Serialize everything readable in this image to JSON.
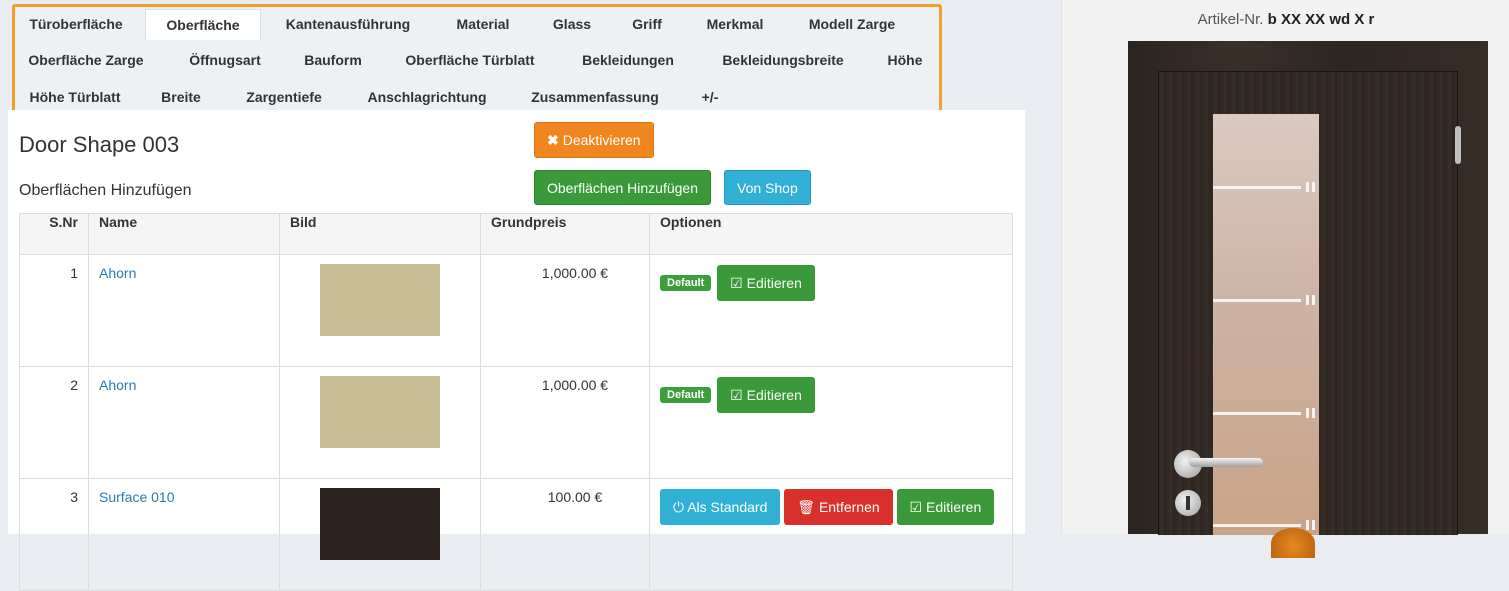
{
  "tabs": {
    "row1": [
      "Türoberfläche",
      "Oberfläche",
      "Kantenausführung",
      "Material",
      "Glass",
      "Griff",
      "Merkmal",
      "Modell Zarge"
    ],
    "row2": [
      "Oberfläche Zarge",
      "Öffnugsart",
      "Bauform",
      "Oberfläche Türblatt",
      "Bekleidungen",
      "Bekleidungsbreite",
      "Höhe"
    ],
    "row3": [
      "Höhe Türblatt",
      "Breite",
      "Zargentiefe",
      "Anschlagrichtung",
      "Zusammenfassung",
      "+/-"
    ],
    "active": "Oberfläche"
  },
  "main": {
    "title": "Door Shape 003",
    "section_title": "Oberflächen Hinzufügen",
    "deactivate_label": "Deaktivieren",
    "add_surfaces_label": "Oberflächen Hinzufügen",
    "from_shop_label": "Von Shop"
  },
  "table": {
    "headers": [
      "S.Nr",
      "Name",
      "Bild",
      "Grundpreis",
      "Optionen"
    ],
    "rows": [
      {
        "nr": "1",
        "name": "Ahorn",
        "price": "1,000.00 €",
        "swatch_color": "#c9bd94",
        "default": "Default",
        "edit": "Editieren"
      },
      {
        "nr": "2",
        "name": "Ahorn",
        "price": "1,000.00 €",
        "swatch_color": "#c9bd94",
        "default": "Default",
        "edit": "Editieren"
      },
      {
        "nr": "3",
        "name": "Surface 010",
        "price": "100.00 €",
        "swatch_color": "#2d241f",
        "set_default": "Als Standard",
        "remove": "Entfernen",
        "edit": "Editieren"
      }
    ]
  },
  "preview": {
    "artikel_prefix": "Artikel-Nr.",
    "artikel_code": "b XX XX wd X r"
  },
  "colors": {
    "tab_border": "#f0a02c",
    "orange": "#f0861f",
    "green": "#3a9a3a",
    "cyan": "#31b0d5",
    "red": "#d9302c",
    "link": "#2a7ab8"
  }
}
